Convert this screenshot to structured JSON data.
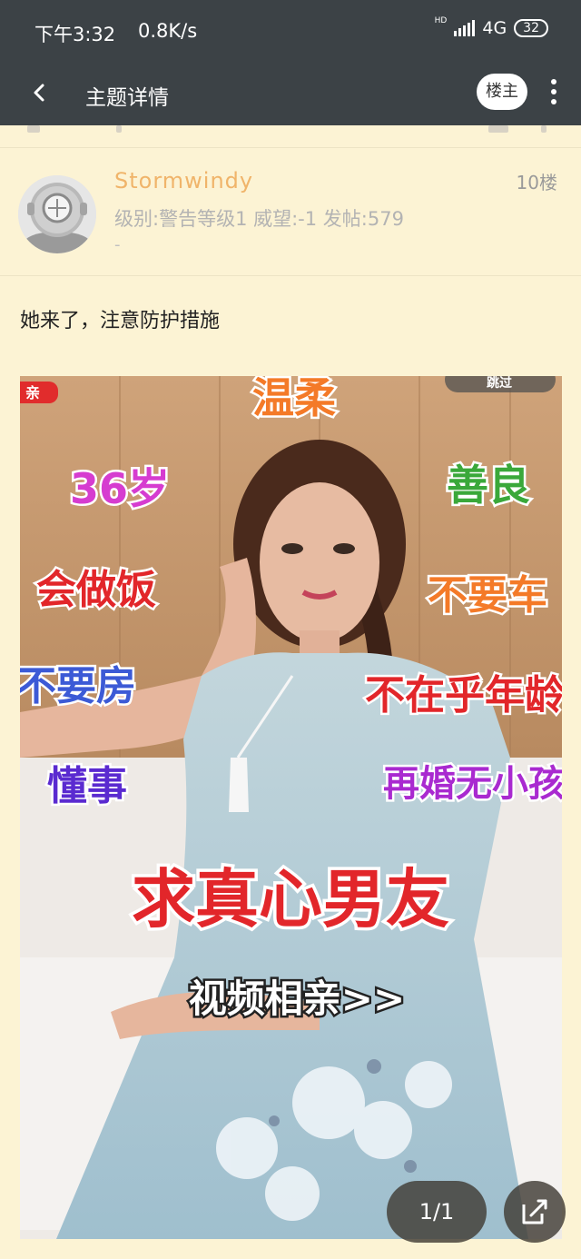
{
  "status_bar": {
    "time": "下午3:32",
    "net_speed": "0.8K/s",
    "hd_label": "HD",
    "network": "4G",
    "battery": "32"
  },
  "app_bar": {
    "title": "主题详情",
    "owner_button": "楼主"
  },
  "post": {
    "username": "Stormwindy",
    "meta": "级别:警告等级1   威望:-1   发帖:579",
    "dash": "-",
    "floor": "10楼",
    "text": "她来了，注意防护措施"
  },
  "image_overlay": {
    "tag_left": "亲",
    "tag_top_right": "跳过",
    "gentle": "温柔",
    "age": "36岁",
    "kind": "善良",
    "cook": "会做饭",
    "no_car": "不要车",
    "no_house": "不要房",
    "age_ok": "不在乎年龄",
    "sensible": "懂事",
    "remarried": "再婚无小孩",
    "seeking": "求真心男友",
    "video": "视频相亲>>"
  },
  "pager": {
    "label": "1/1"
  },
  "colors": {
    "bar_bg": "#3c4246",
    "page_bg": "#fcf3d4",
    "username": "#f0b46a"
  }
}
